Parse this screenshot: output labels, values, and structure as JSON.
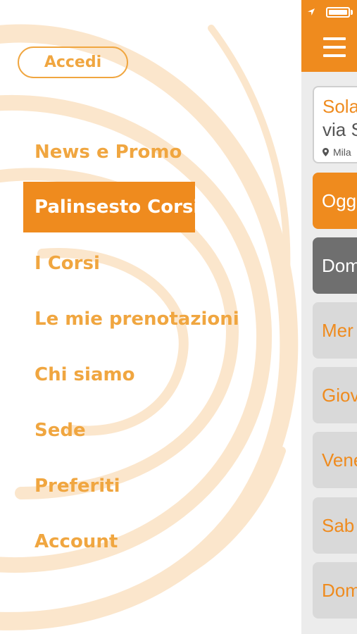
{
  "drawer": {
    "login_label": "Accedi",
    "menu": [
      {
        "label": "News e Promo",
        "active": false
      },
      {
        "label": "Palinsesto Corsi",
        "active": true
      },
      {
        "label": "I Corsi",
        "active": false
      },
      {
        "label": "Le mie prenotazioni",
        "active": false
      },
      {
        "label": "Chi siamo",
        "active": false
      },
      {
        "label": "Sede",
        "active": false
      },
      {
        "label": "Preferiti",
        "active": false
      },
      {
        "label": "Account",
        "active": false
      }
    ]
  },
  "main": {
    "venue": {
      "name": "Sola",
      "street": "via S",
      "city": "Mila"
    },
    "days": [
      {
        "label": "Ogg",
        "state": "today"
      },
      {
        "label": "Dom",
        "state": "selected"
      },
      {
        "label": "Mer",
        "state": "normal"
      },
      {
        "label": "Giov",
        "state": "normal"
      },
      {
        "label": "Vene",
        "state": "normal"
      },
      {
        "label": "Sab",
        "state": "normal"
      },
      {
        "label": "Dom",
        "state": "normal"
      }
    ]
  },
  "colors": {
    "accent": "#ef8b1e",
    "accent_light": "#f0a640",
    "swirl": "#fbe6cc",
    "day_selected": "#6f6f6f",
    "day_normal": "#d9d9d9"
  }
}
